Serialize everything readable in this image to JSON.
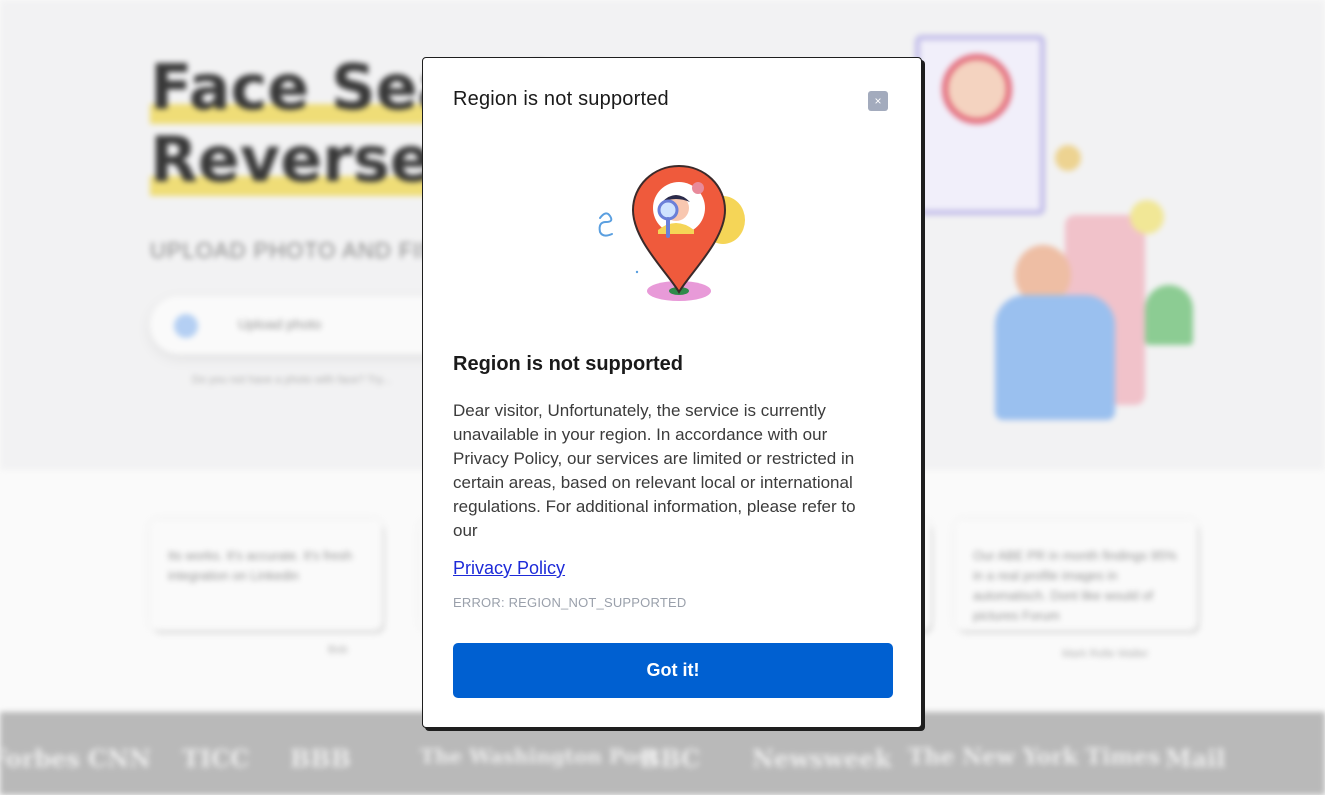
{
  "background": {
    "hero_title_line1": "Face Search",
    "hero_title_line2": "Reverse Image",
    "hero_subtitle": "UPLOAD PHOTO AND FIND",
    "search_placeholder": "Upload photo",
    "search_note": "Do you not have a photo with face? Try...",
    "testimonials": [
      {
        "text": "Its works. It's accurate. It's fresh integration on Linkedin",
        "author": "Bob"
      },
      {
        "text": "...",
        "author": ""
      },
      {
        "text": "...",
        "author": ""
      },
      {
        "text": "Our ABE PR in month findings 95% in a real profile images in automatisch. Dont like would of pictures Forum",
        "author": "Mark Rolle Waller"
      }
    ],
    "press_logos": [
      "Forbes",
      "CNN",
      "TICC",
      "BBB",
      "The Washington Post",
      "BBC",
      "Newsweek",
      "The New York Times",
      "Mail"
    ]
  },
  "modal": {
    "header_title": "Region is not supported",
    "close_label": "×",
    "title": "Region is not supported",
    "body": "Dear visitor, Unfortunately, the service is currently unavailable in your region. In accordance with our Privacy Policy, our services are limited or restricted in certain areas, based on relevant local or international regulations. For additional information, please refer to our",
    "link_text": "Privacy Policy",
    "error_code": "ERROR: REGION_NOT_SUPPORTED",
    "button_label": "Got it!"
  },
  "colors": {
    "primary_button": "#0060d1",
    "link": "#1d2ad8",
    "pin": "#ef5a3c",
    "close_button": "#a3abbd"
  }
}
